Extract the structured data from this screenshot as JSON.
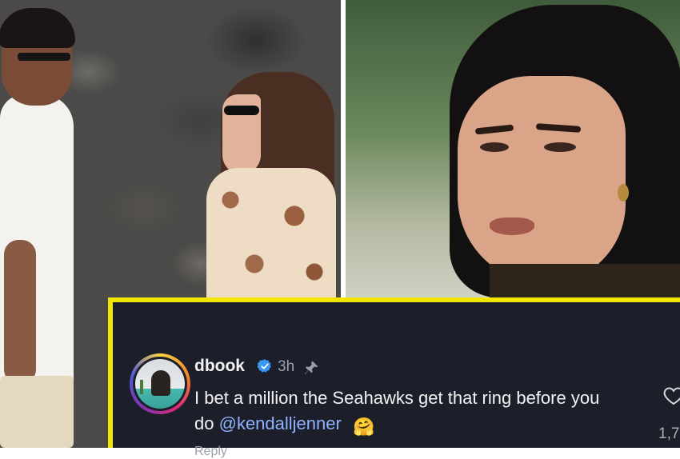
{
  "comment": {
    "username": "dbook",
    "timestamp": "3h",
    "text": "I bet a million the Seahawks get that ring before you do",
    "mention": "@kendalljenner",
    "emoji": "🤗",
    "like_count": "1,7",
    "reply_label": "Reply"
  },
  "icons": {
    "verified": "verified-badge-icon",
    "pin": "pin-icon",
    "heart": "heart-outline-icon"
  },
  "colors": {
    "card_background": "#1c1f2a",
    "card_border": "#f2e600",
    "verified_blue": "#3897f0",
    "mention_blue": "#8fb3ff"
  }
}
